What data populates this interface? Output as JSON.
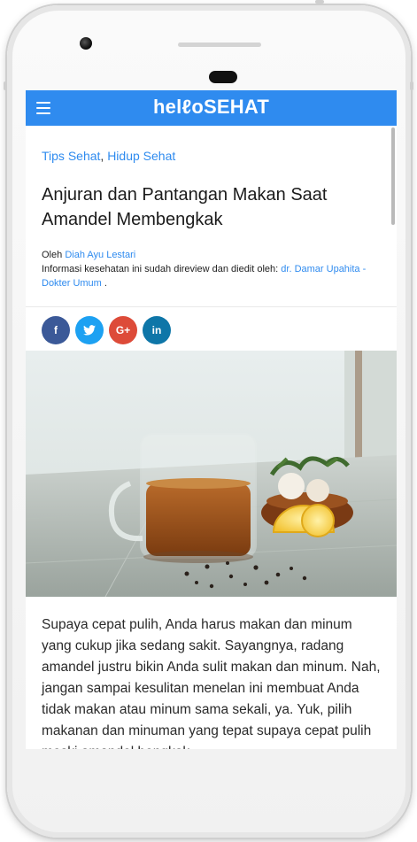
{
  "header": {
    "logo_text": "hellosehat",
    "logo_display": "helℓoSEHAT",
    "accent_color": "#2f8bef"
  },
  "article": {
    "categories": [
      "Tips Sehat",
      "Hidup Sehat"
    ],
    "category_separator": ",",
    "title": "Anjuran dan Pantangan Makan Saat Amandel Membengkak",
    "byline_prefix": "Oleh",
    "author": "Diah Ayu Lestari",
    "review_text": "Informasi kesehatan ini sudah direview dan diedit oleh:",
    "reviewer": "dr. Damar Upahita - Dokter Umum",
    "review_suffix": ".",
    "body": "Supaya cepat pulih, Anda harus makan dan minum yang cukup jika sedang sakit. Sayangnya, radang amandel justru bikin Anda sulit makan dan minum. Nah, jangan sampai kesulitan menelan ini membuat Anda tidak makan atau minum sama sekali, ya. Yuk, pilih makanan dan minuman yang tepat supaya cepat pulih meski amandel bengkak."
  },
  "share": {
    "facebook_label": "f",
    "twitter_icon": "twitter-bird-icon",
    "googleplus_label": "G+",
    "linkedin_label": "in"
  }
}
